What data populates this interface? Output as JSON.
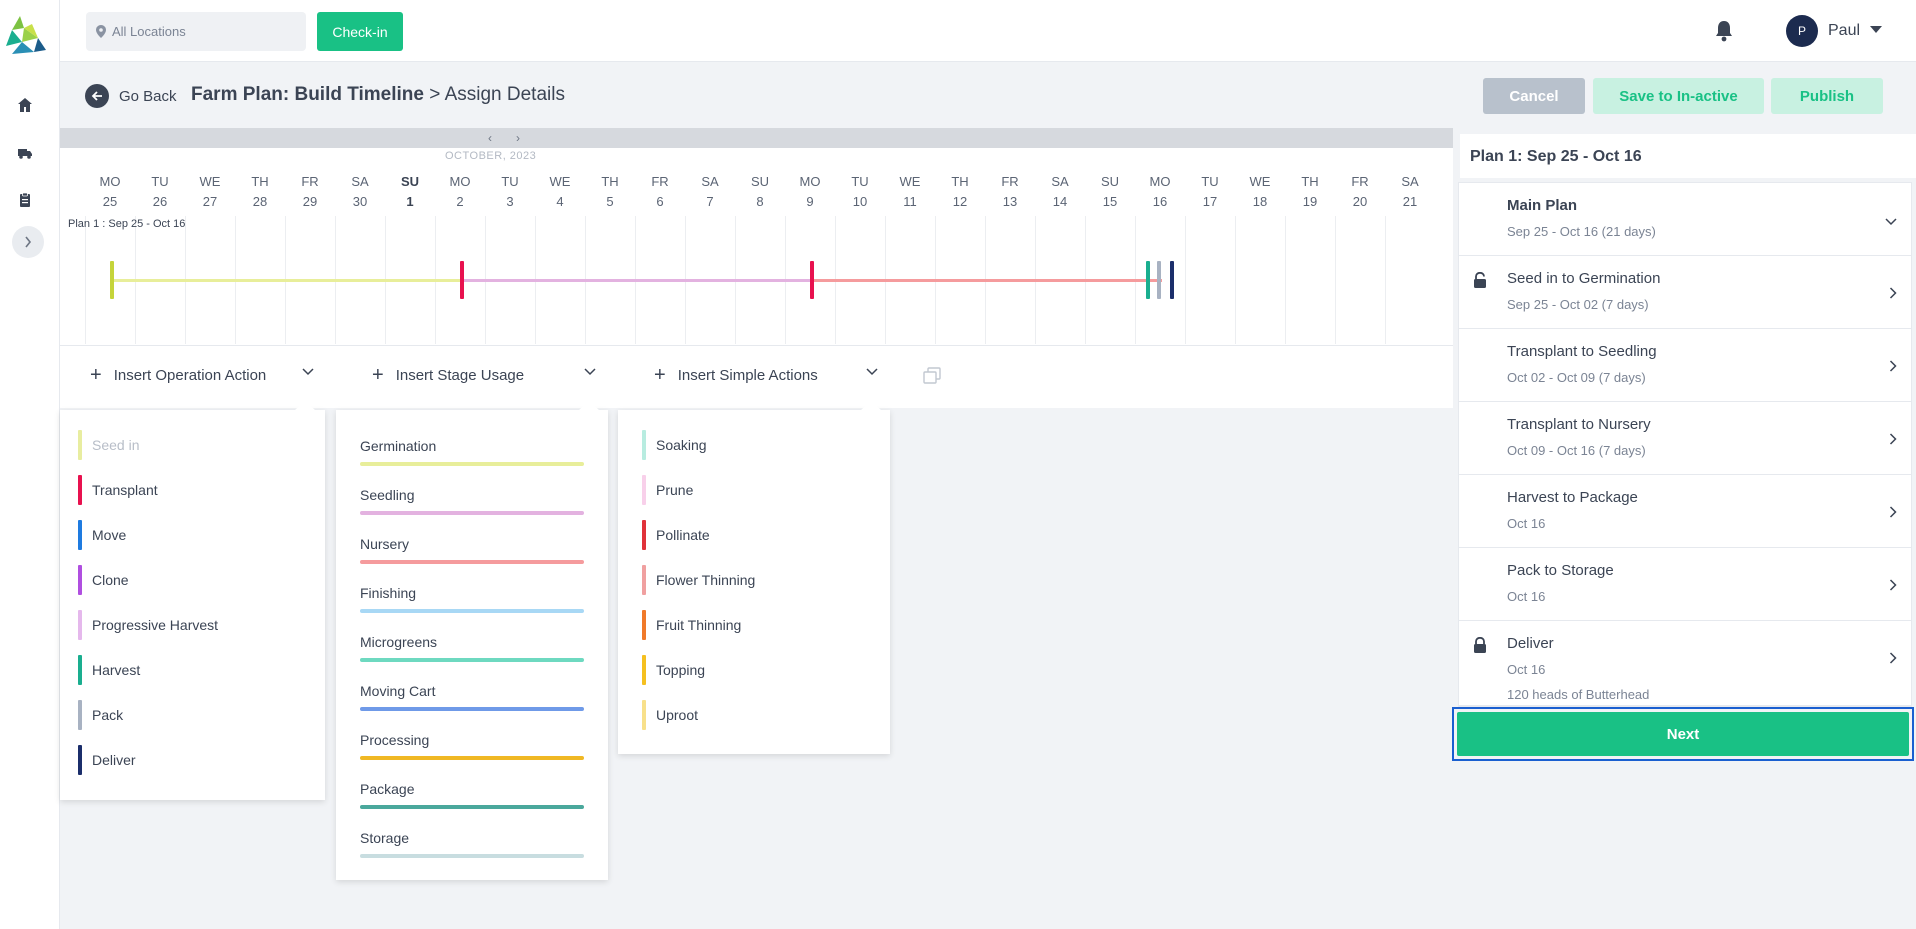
{
  "header": {
    "location_placeholder": "All Locations",
    "checkin_label": "Check-in",
    "user_initial": "P",
    "user_name": "Paul"
  },
  "title_row": {
    "go_back": "Go Back",
    "title_bold": "Farm Plan: Build Timeline",
    "title_rest": " > Assign Details",
    "cancel": "Cancel",
    "save_inactive": "Save to In-active",
    "publish": "Publish"
  },
  "timeline": {
    "month": "OCTOBER, 2023",
    "plan_label": "Plan 1 : Sep 25 - Oct 16",
    "days": [
      {
        "dow": "MO",
        "num": "25"
      },
      {
        "dow": "TU",
        "num": "26"
      },
      {
        "dow": "WE",
        "num": "27"
      },
      {
        "dow": "TH",
        "num": "28"
      },
      {
        "dow": "FR",
        "num": "29"
      },
      {
        "dow": "SA",
        "num": "30"
      },
      {
        "dow": "SU",
        "num": "1"
      },
      {
        "dow": "MO",
        "num": "2"
      },
      {
        "dow": "TU",
        "num": "3"
      },
      {
        "dow": "WE",
        "num": "4"
      },
      {
        "dow": "TH",
        "num": "5"
      },
      {
        "dow": "FR",
        "num": "6"
      },
      {
        "dow": "SA",
        "num": "7"
      },
      {
        "dow": "SU",
        "num": "8"
      },
      {
        "dow": "MO",
        "num": "9"
      },
      {
        "dow": "TU",
        "num": "10"
      },
      {
        "dow": "WE",
        "num": "11"
      },
      {
        "dow": "TH",
        "num": "12"
      },
      {
        "dow": "FR",
        "num": "13"
      },
      {
        "dow": "SA",
        "num": "14"
      },
      {
        "dow": "SU",
        "num": "15"
      },
      {
        "dow": "MO",
        "num": "16"
      },
      {
        "dow": "TU",
        "num": "17"
      },
      {
        "dow": "WE",
        "num": "18"
      },
      {
        "dow": "TH",
        "num": "19"
      },
      {
        "dow": "FR",
        "num": "20"
      },
      {
        "dow": "SA",
        "num": "21"
      }
    ]
  },
  "actions": {
    "insert_operation": "Insert Operation Action",
    "insert_stage": "Insert Stage Usage",
    "insert_simple": "Insert Simple Actions"
  },
  "operation_actions": [
    {
      "label": "Seed in",
      "color": "#e8eda0",
      "disabled": true
    },
    {
      "label": "Transplant",
      "color": "#e8114f"
    },
    {
      "label": "Move",
      "color": "#1e7be0"
    },
    {
      "label": "Clone",
      "color": "#b04fe0"
    },
    {
      "label": "Progressive Harvest",
      "color": "#e5b8ec"
    },
    {
      "label": "Harvest",
      "color": "#1aae8f"
    },
    {
      "label": "Pack",
      "color": "#a8b2c2"
    },
    {
      "label": "Deliver",
      "color": "#1b2e6b"
    }
  ],
  "stage_usages": [
    {
      "label": "Germination",
      "color": "#e8ee9a"
    },
    {
      "label": "Seedling",
      "color": "#e3b2e0"
    },
    {
      "label": "Nursery",
      "color": "#f59b9d"
    },
    {
      "label": "Finishing",
      "color": "#a8d8f5"
    },
    {
      "label": "Microgreens",
      "color": "#6ed9c0"
    },
    {
      "label": "Moving Cart",
      "color": "#6f9ae8"
    },
    {
      "label": "Processing",
      "color": "#f0b824"
    },
    {
      "label": "Package",
      "color": "#4aa89c"
    },
    {
      "label": "Storage",
      "color": "#c8dde0"
    }
  ],
  "simple_actions": [
    {
      "label": "Soaking",
      "color": "#b8ece0"
    },
    {
      "label": "Prune",
      "color": "#f8d0ea"
    },
    {
      "label": "Pollinate",
      "color": "#e0323a"
    },
    {
      "label": "Flower Thinning",
      "color": "#f0a0a0"
    },
    {
      "label": "Fruit Thinning",
      "color": "#f07a2a"
    },
    {
      "label": "Topping",
      "color": "#f5c020"
    },
    {
      "label": "Uproot",
      "color": "#f8e08a"
    }
  ],
  "plan_panel": {
    "title": "Plan 1: Sep 25 - Oct 16",
    "items": [
      {
        "title": "Main Plan",
        "sub": "Sep 25 - Oct 16 (21 days)"
      },
      {
        "title": "Seed in to Germination",
        "sub": "Sep 25 - Oct 02 (7 days)"
      },
      {
        "title": "Transplant to Seedling",
        "sub": "Oct 02 - Oct 09 (7 days)"
      },
      {
        "title": "Transplant to Nursery",
        "sub": "Oct 09 - Oct 16 (7 days)"
      },
      {
        "title": "Harvest to Package",
        "sub": "Oct 16"
      },
      {
        "title": "Pack to Storage",
        "sub": "Oct 16"
      },
      {
        "title": "Deliver",
        "sub": "Oct 16",
        "sub2": "120 heads of Butterhead"
      }
    ],
    "next": "Next"
  }
}
